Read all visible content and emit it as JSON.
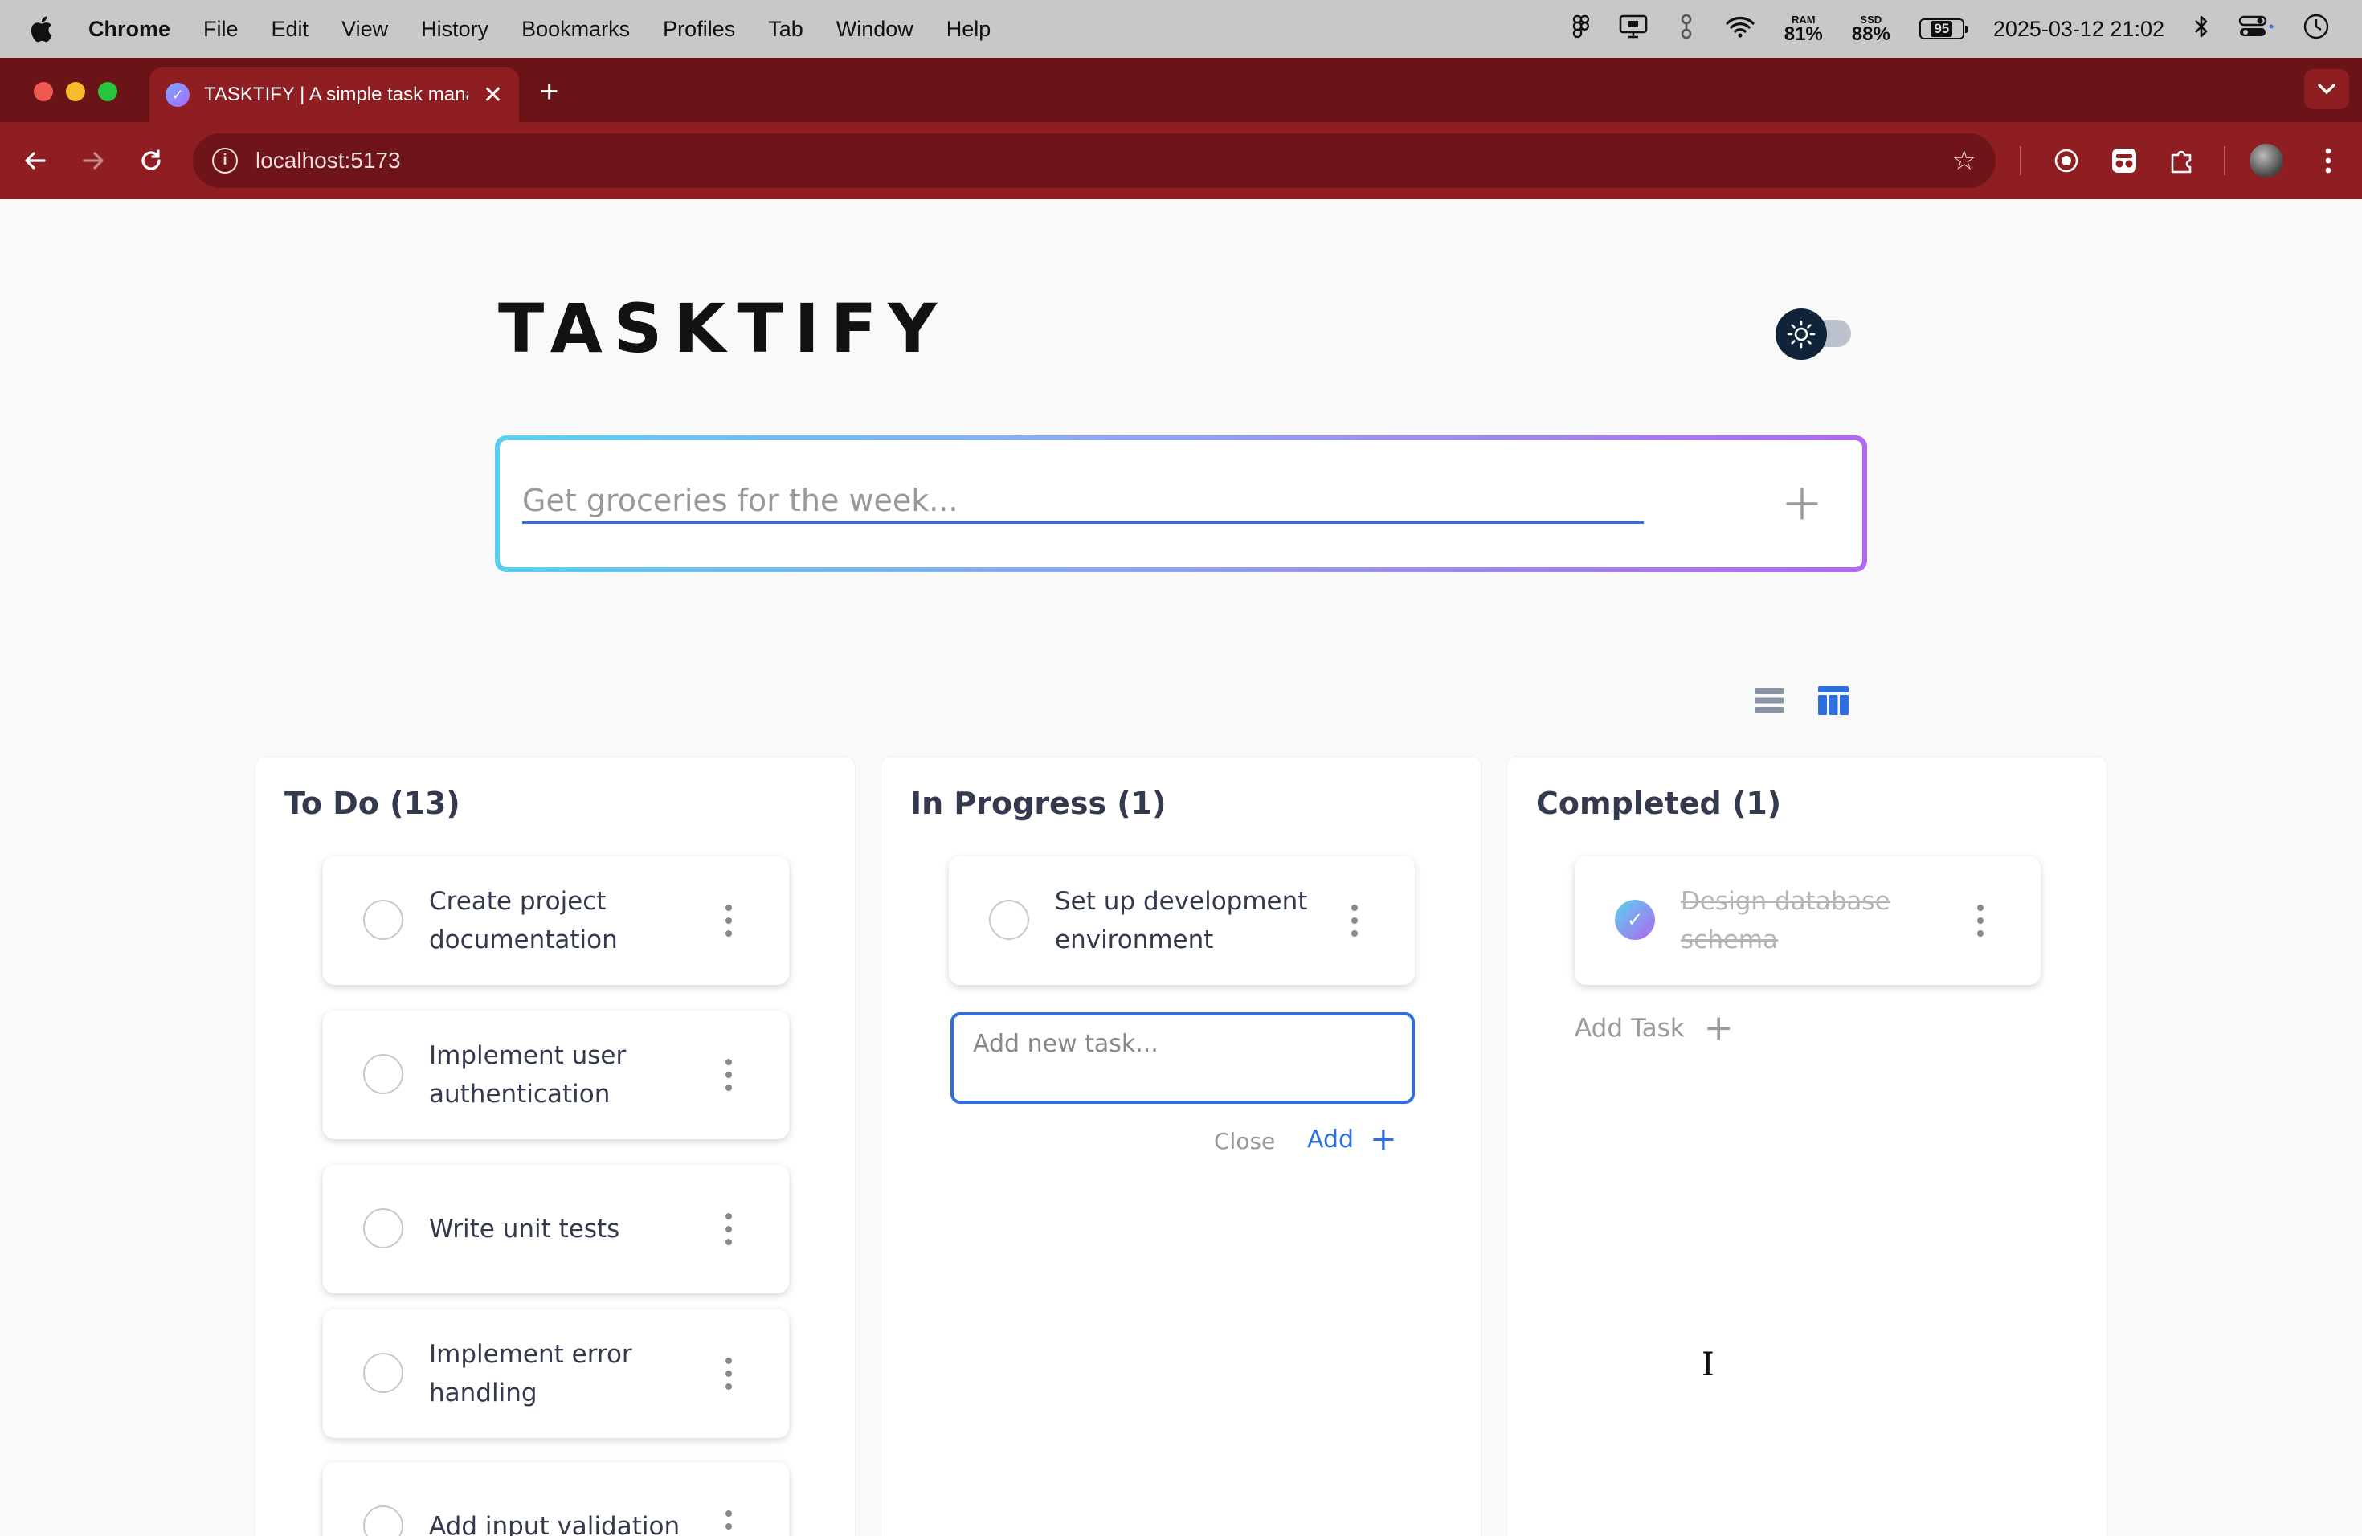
{
  "menubar": {
    "app_name": "Chrome",
    "items": [
      "File",
      "Edit",
      "View",
      "History",
      "Bookmarks",
      "Profiles",
      "Tab",
      "Window",
      "Help"
    ],
    "ram_label": "RAM",
    "ram_value": "81%",
    "ssd_label": "SSD",
    "ssd_value": "88%",
    "battery": "95",
    "datetime": "2025-03-12 21:02"
  },
  "browser": {
    "tab_title": "TASKTIFY | A simple task manager",
    "url": "localhost:5173"
  },
  "app": {
    "title": "TASKTIFY",
    "task_input_placeholder": "Get groceries for the week...",
    "columns": [
      {
        "title": "To Do (13)",
        "tasks": [
          {
            "text": "Create project documentation",
            "done": false
          },
          {
            "text": "Implement user authentication",
            "done": false
          },
          {
            "text": "Write unit tests",
            "done": false
          },
          {
            "text": "Implement error handling",
            "done": false
          },
          {
            "text": "Add input validation",
            "done": false
          }
        ]
      },
      {
        "title": "In Progress (1)",
        "tasks": [
          {
            "text": "Set up development environment",
            "done": false
          }
        ],
        "new_task_placeholder": "Add new task...",
        "close_label": "Close",
        "add_label": "Add"
      },
      {
        "title": "Completed (1)",
        "tasks": [
          {
            "text": "Design database schema",
            "done": true
          }
        ],
        "add_task_label": "Add Task"
      }
    ]
  },
  "colors": {
    "accent_blue": "#2f6fdd",
    "gradient_start": "#5ad0ee",
    "gradient_end": "#b068ef",
    "chrome_theme": "#8e1e22"
  }
}
